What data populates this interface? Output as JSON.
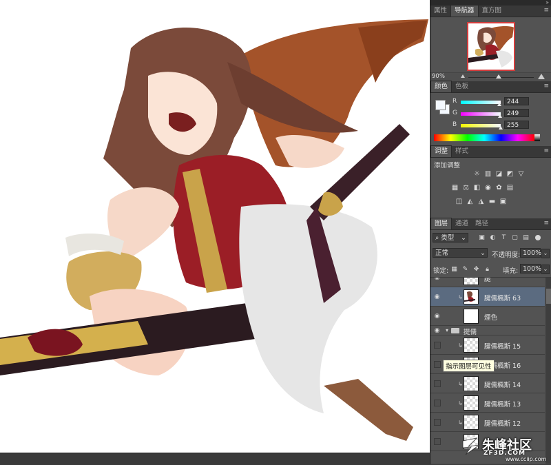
{
  "panels": {
    "top_tabs": [
      "属性",
      "导航器",
      "直方图"
    ],
    "top_active": 1,
    "navigator": {
      "zoom": "90%"
    },
    "color_tabs": [
      "颜色",
      "色板"
    ],
    "color": {
      "fg_hex": "#f4f9ff",
      "channels": [
        {
          "label": "R",
          "value": "244",
          "fraction": 0.957
        },
        {
          "label": "G",
          "value": "249",
          "fraction": 0.976
        },
        {
          "label": "B",
          "value": "255",
          "fraction": 1.0
        }
      ]
    },
    "adjust_tabs": [
      "调整",
      "样式"
    ],
    "adjust_title": "添加调整",
    "layers_tabs": [
      "图层",
      "通道",
      "路径"
    ],
    "layers": {
      "filter": "类型",
      "blend_mode": "正常",
      "opacity_label": "不透明度:",
      "opacity": "100%",
      "lock_label": "锁定:",
      "fill_label": "填充:",
      "fill": "100%",
      "rows": [
        {
          "name": "腿",
          "visible": true,
          "clip": false,
          "selected": false,
          "thumb": "blank"
        },
        {
          "name": "腱儒楓斯 63",
          "visible": true,
          "clip": true,
          "selected": true,
          "thumb": "char"
        },
        {
          "name": "煙色",
          "visible": true,
          "clip": false,
          "selected": false,
          "thumb": "blank"
        },
        {
          "name": "提儒",
          "visible": true,
          "clip": false,
          "selected": false,
          "thumb": "folder"
        },
        {
          "name": "腱儒楓斯 15",
          "visible": false,
          "clip": true,
          "selected": false,
          "thumb": "check"
        },
        {
          "name": "腱儒楓斯 16",
          "visible": false,
          "clip": true,
          "selected": false,
          "thumb": "check"
        },
        {
          "name": "腱儒楓斯 14",
          "visible": false,
          "clip": true,
          "selected": false,
          "thumb": "check"
        },
        {
          "name": "腱儒楓斯 13",
          "visible": false,
          "clip": true,
          "selected": false,
          "thumb": "check"
        },
        {
          "name": "腱儒楓斯 12",
          "visible": false,
          "clip": true,
          "selected": false,
          "thumb": "check"
        }
      ]
    }
  },
  "tooltip": "指示图层可见性",
  "watermark": {
    "brand": "朱峰社区",
    "domain1": "ZF3D.COM",
    "domain2": "www.cciip.com"
  }
}
